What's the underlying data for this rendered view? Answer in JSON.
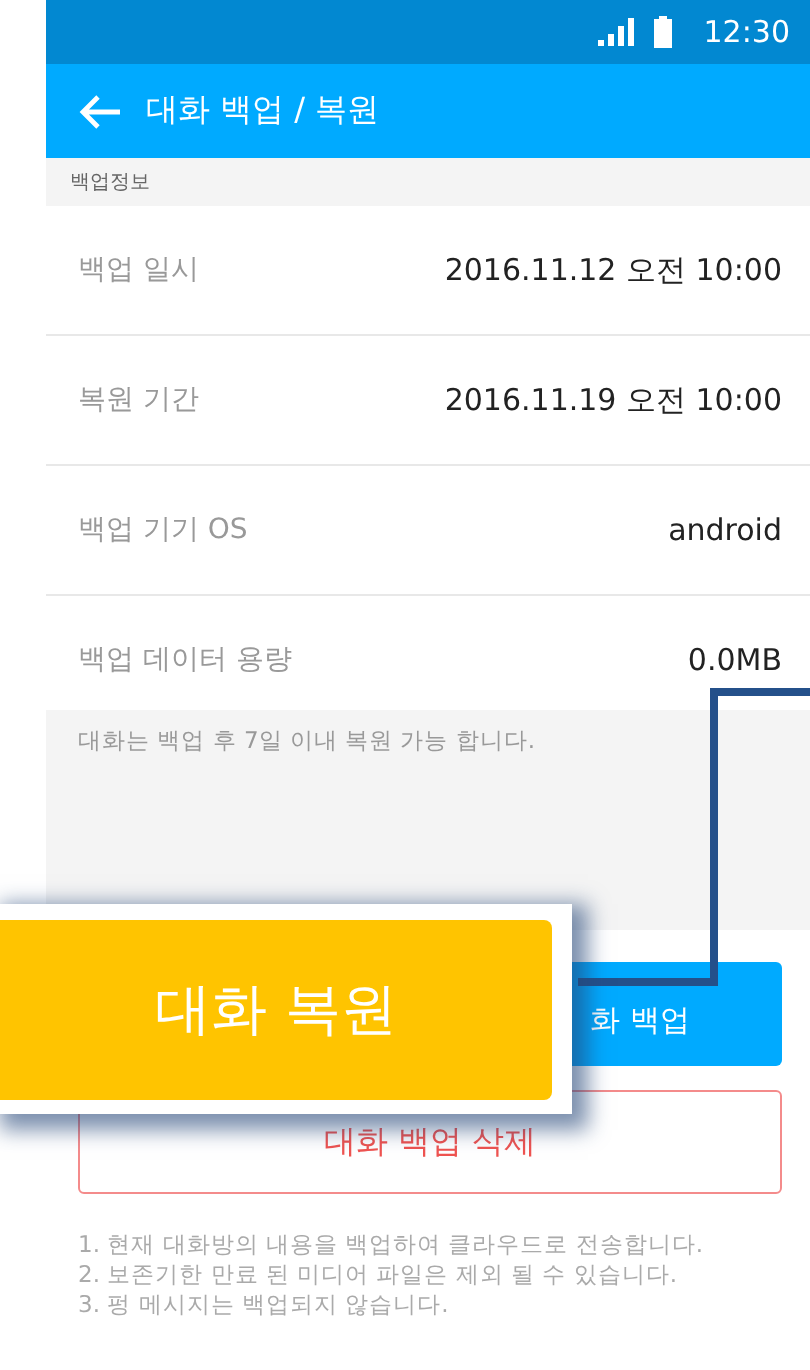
{
  "status_bar": {
    "time": "12:30"
  },
  "app_bar": {
    "title": "대화 백업 / 복원"
  },
  "section": {
    "title": "백업정보"
  },
  "rows": [
    {
      "label": "백업 일시",
      "value": "2016.11.12 오전 10:00"
    },
    {
      "label": "복원 기간",
      "value": "2016.11.19 오전 10:00"
    },
    {
      "label": "백업 기기 OS",
      "value": "android"
    },
    {
      "label": "백업 데이터 용량",
      "value": "0.0MB"
    }
  ],
  "notice": "대화는 백업 후 7일 이내 복원 가능 합니다.",
  "buttons": [
    {
      "kind": "primary",
      "label": "화 백업"
    },
    {
      "kind": "danger",
      "label": "대화 백업 삭제"
    }
  ],
  "notes": [
    "1. 현재 대화방의 내용을 백업하여 클라우드로 전송합니다.",
    "2. 보존기한 만료 된 미디어 파일은 제외 될 수 있습니다.",
    "3. 펑 메시지는 백업되지 않습니다."
  ],
  "callout": {
    "label": "대화 복원"
  }
}
